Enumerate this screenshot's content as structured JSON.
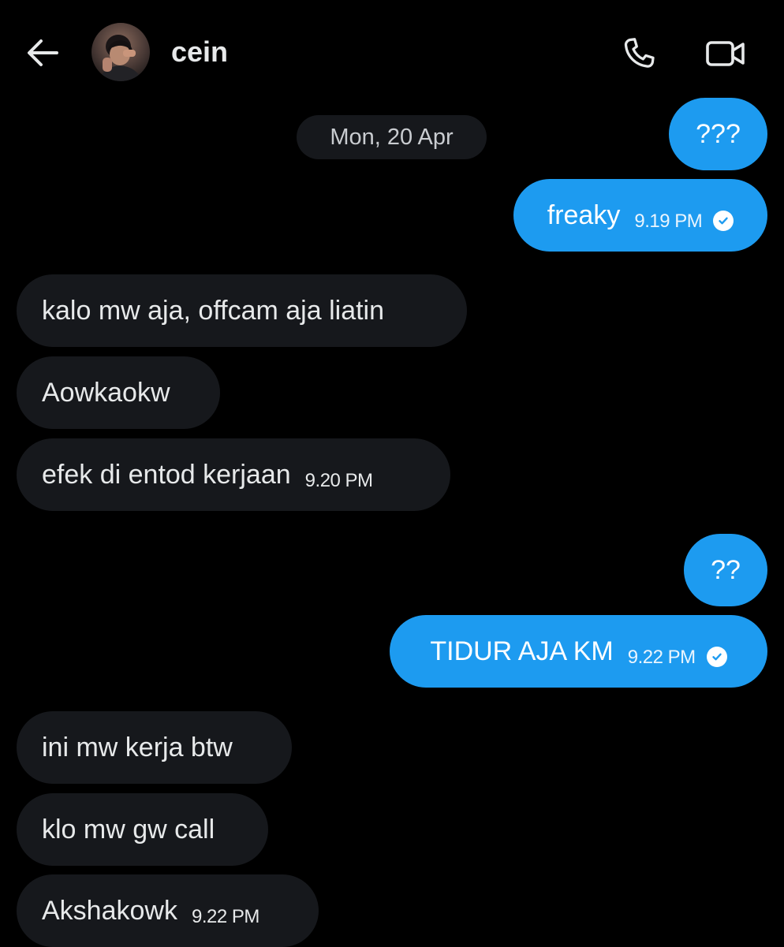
{
  "header": {
    "contact_name": "cein",
    "back_icon": "arrow-left-icon",
    "call_icon": "phone-icon",
    "video_icon": "video-camera-icon"
  },
  "date_separator": "Mon, 20 Apr",
  "messages": [
    {
      "direction": "sent",
      "text": "???"
    },
    {
      "direction": "sent",
      "text": "freaky",
      "time": "9.19 PM",
      "status": "read"
    },
    {
      "direction": "received",
      "text": "kalo mw aja, offcam aja liatin"
    },
    {
      "direction": "received",
      "text": "Aowkaokw"
    },
    {
      "direction": "received",
      "text": "efek di entod kerjaan",
      "time": "9.20 PM"
    },
    {
      "direction": "sent",
      "text": "??"
    },
    {
      "direction": "sent",
      "text": "TIDUR AJA KM",
      "time": "9.22 PM",
      "status": "read"
    },
    {
      "direction": "received",
      "text": "ini mw kerja btw"
    },
    {
      "direction": "received",
      "text": "klo mw gw call"
    },
    {
      "direction": "received",
      "text": "Akshakowk",
      "time": "9.22 PM"
    }
  ],
  "colors": {
    "background": "#000000",
    "sent_bubble": "#1d9bf0",
    "received_bubble": "#16181c",
    "text": "#e7e9ea"
  }
}
